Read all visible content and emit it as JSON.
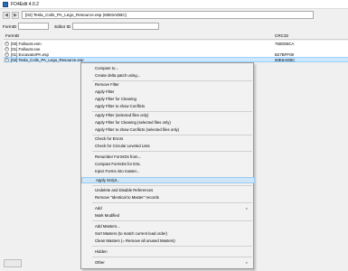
{
  "window": {
    "title": "FO4Edit 4.0.2"
  },
  "toolbar": {
    "back_glyph": "◀",
    "forward_glyph": "▶",
    "path": "[02] Tesla_Coils_PA_Lego_Resource.esp (60E6ADBC)"
  },
  "search": {
    "formid_label": "FormID",
    "editorid_label": "Editor ID"
  },
  "tree": {
    "headers": {
      "formid": "FormID",
      "crc": "CRC32"
    },
    "rows": [
      {
        "name": "[00] Fallout4.esm",
        "crc": "750D06CA",
        "expander": "+"
      },
      {
        "name": "[01] Fallout4.exe",
        "crc": "",
        "expander": "+"
      },
      {
        "name": "[01] ExcavatorPA.esp",
        "crc": "B27BFF08",
        "expander": "+"
      },
      {
        "name": "[02] Tesla_Coils_PA_Lego_Resource.esp",
        "crc": "60E6ADBC",
        "expander": "+"
      }
    ]
  },
  "menu": {
    "compare_to": "Compare to...",
    "create_delta": "Create delta patch using...",
    "remove_filter": "Remove Filter",
    "apply_filter": "Apply Filter",
    "apply_filter_cleaning": "Apply Filter for Cleaning",
    "apply_filter_conflicts": "Apply Filter to show Conflicts",
    "apply_filter_sel": "Apply Filter (selected files only)",
    "apply_filter_cleaning_sel": "Apply Filter for Cleaning (selected files only)",
    "apply_filter_conflicts_sel": "Apply Filter to show Conflicts (selected files only)",
    "check_errors": "Check for Errors",
    "check_circular": "Check for Circular Leveled Lists",
    "renumber": "Renumber FormIDs from...",
    "compact_esl": "Compact FormIDs for ESL",
    "inject_forms": "Inject Forms into master...",
    "apply_script": "Apply Script...",
    "undelete": "Undelete and Disable References",
    "remove_itm": "Remove \"Identical to Master\" records",
    "add": "Add",
    "mark_modified": "Mark Modified",
    "add_masters": "Add Masters...",
    "sort_masters": "Sort Masters (to match current load order)",
    "clean_masters": "Clean Masters (= Remove all unused Masters)",
    "hidden": "Hidden",
    "other": "Other",
    "submenu_arrow": ">"
  }
}
